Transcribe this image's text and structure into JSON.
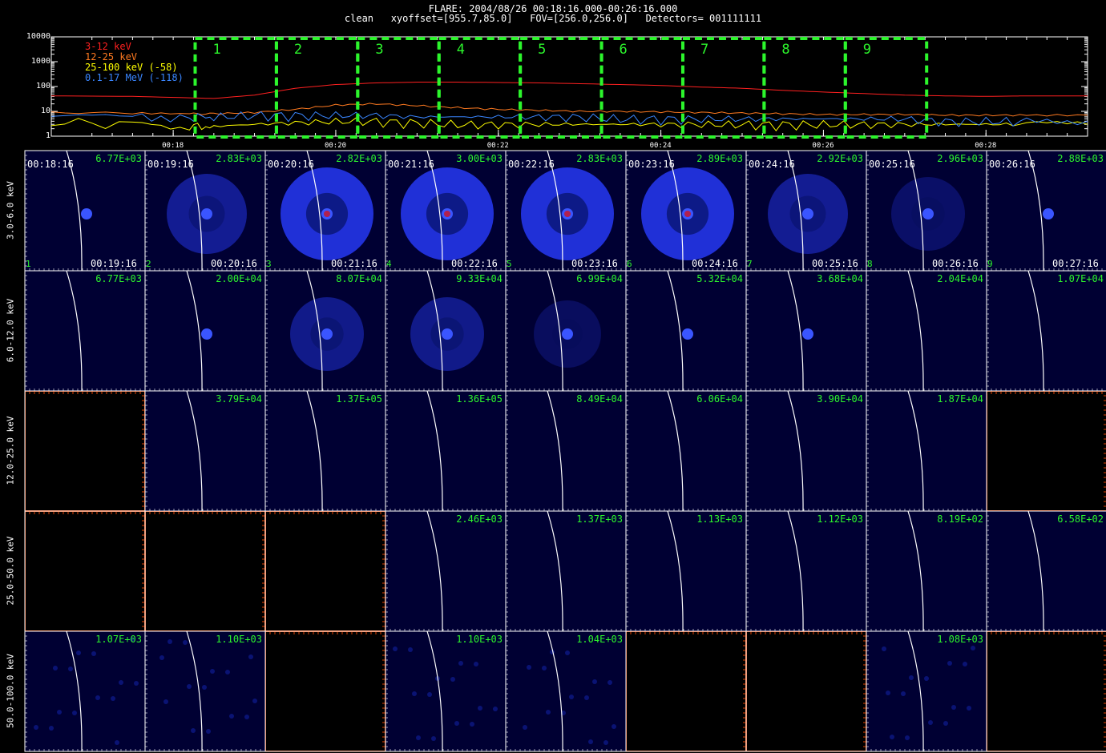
{
  "header": {
    "line1": "FLARE: 2004/08/26 00:18:16.000-00:26:16.000",
    "line2": "clean   xyoffset=[955.7,85.0]   FOV=[256.0,256.0]   Detectors= 001111111"
  },
  "chart_data": [
    {
      "type": "line",
      "yscale": "log",
      "ylim": [
        1,
        10000
      ],
      "yticks": [
        "10000",
        "1000",
        "100",
        "10",
        "1"
      ],
      "xticks": [
        "00:18",
        "00:20",
        "00:22",
        "00:24",
        "00:26",
        "00:28"
      ],
      "xlim_minutes": [
        16.5,
        29.25
      ],
      "legend": [
        {
          "label": "3-12 keV",
          "color": "#ff2020"
        },
        {
          "label": "12-25 keV",
          "color": "#ff7a20"
        },
        {
          "label": "25-100 keV (-58)",
          "color": "#ffff00"
        },
        {
          "label": "0.1-17 MeV (-118)",
          "color": "#3a86ff"
        }
      ],
      "x_minutes": [
        16.5,
        17.5,
        18.2,
        18.5,
        19.0,
        19.5,
        20.0,
        20.5,
        21.0,
        21.5,
        22.0,
        22.5,
        23.0,
        23.5,
        24.0,
        24.5,
        25.0,
        25.5,
        26.0,
        26.5,
        27.0,
        27.5,
        28.0,
        28.5,
        29.25
      ],
      "series": [
        {
          "name": "3-12 keV",
          "values": [
            42,
            40,
            35,
            33,
            45,
            85,
            120,
            140,
            150,
            150,
            145,
            140,
            130,
            120,
            110,
            95,
            85,
            70,
            60,
            52,
            45,
            42,
            40,
            42,
            42
          ]
        },
        {
          "name": "12-25 keV",
          "values": [
            9,
            8.5,
            8,
            8,
            9,
            12,
            18,
            20,
            17,
            14,
            12,
            11,
            10,
            10,
            9.5,
            9,
            8.5,
            8,
            7.5,
            7.5,
            7.5,
            7,
            7,
            7,
            7
          ]
        },
        {
          "name": "25-100 keV (-58)",
          "values": [
            4,
            3,
            2.5,
            2.5,
            3,
            3.5,
            4,
            4,
            3.5,
            3,
            3,
            3,
            3,
            3,
            3,
            3,
            3,
            3,
            3,
            3,
            3,
            3,
            3,
            3,
            3
          ]
        },
        {
          "name": "0.1-17 MeV (-118)",
          "values": [
            7,
            7,
            6,
            6,
            7,
            7,
            7,
            7,
            6,
            6,
            6,
            6,
            6,
            5,
            5,
            5,
            5,
            5,
            5,
            5,
            5,
            4,
            4,
            4,
            4
          ]
        }
      ],
      "windows": [
        "1",
        "2",
        "3",
        "4",
        "5",
        "6",
        "7",
        "8",
        "9"
      ]
    },
    {
      "type": "heatmap",
      "rows": [
        "3.0-6.0 keV",
        "6.0-12.0 keV",
        "12.0-25.0 keV",
        "25.0-50.0 keV",
        "50.0-100.0 keV"
      ],
      "start_times": [
        "00:18:16",
        "00:19:16",
        "00:20:16",
        "00:21:16",
        "00:22:16",
        "00:23:16",
        "00:24:16",
        "00:25:16",
        "00:26:16"
      ],
      "end_times": [
        "00:19:16",
        "00:20:16",
        "00:21:16",
        "00:22:16",
        "00:23:16",
        "00:24:16",
        "00:25:16",
        "00:26:16",
        "00:27:16"
      ],
      "indices": [
        "1",
        "2",
        "3",
        "4",
        "5",
        "6",
        "7",
        "8",
        "9"
      ],
      "peaks": [
        [
          "6.77E+03",
          "2.83E+03",
          "2.82E+03",
          "3.00E+03",
          "2.83E+03",
          "2.89E+03",
          "2.92E+03",
          "2.96E+03",
          "2.88E+03"
        ],
        [
          "6.77E+03",
          "2.00E+04",
          "8.07E+04",
          "9.33E+04",
          "6.99E+04",
          "5.32E+04",
          "3.68E+04",
          "2.04E+04",
          "1.07E+04"
        ],
        [
          "",
          "3.79E+04",
          "1.37E+05",
          "1.36E+05",
          "8.49E+04",
          "6.06E+04",
          "3.90E+04",
          "1.87E+04",
          ""
        ],
        [
          "",
          "",
          "",
          "2.46E+03",
          "1.37E+03",
          "1.13E+03",
          "1.12E+03",
          "8.19E+02",
          "6.58E+02"
        ],
        [
          "1.07E+03",
          "1.10E+03",
          "",
          "1.10E+03",
          "1.04E+03",
          "",
          "",
          "1.08E+03",
          ""
        ]
      ],
      "kinds": [
        [
          "spot",
          "ring",
          "ringbig",
          "ringbig",
          "ringbig",
          "ringbig",
          "ring",
          "ringfaint",
          "spot"
        ],
        [
          "blank",
          "spot",
          "ring2",
          "ring2",
          "ring3",
          "spot",
          "spot",
          "blank",
          "blank"
        ],
        [
          "empty",
          "blank",
          "blank",
          "blank",
          "blank",
          "blank",
          "blank",
          "blank",
          "empty"
        ],
        [
          "empty",
          "empty",
          "empty",
          "blank",
          "blank",
          "blank",
          "blank",
          "blank",
          "blank"
        ],
        [
          "noise",
          "noise",
          "empty",
          "noise",
          "noise",
          "empty",
          "empty",
          "noise",
          "empty"
        ]
      ],
      "colors": {
        "image_bg": "#000033",
        "empty_bg": "#000000",
        "grid": "#ffffff",
        "empty_axis": "#e04000",
        "peak_text": "#2cf52c"
      }
    }
  ]
}
